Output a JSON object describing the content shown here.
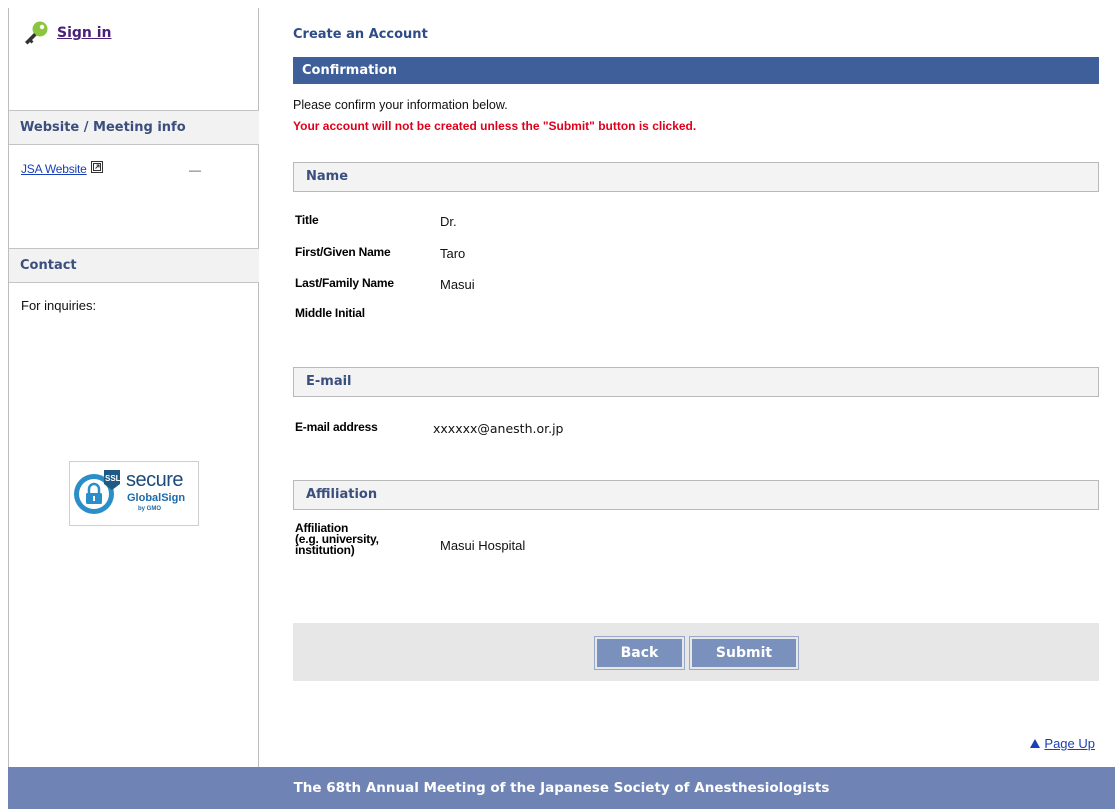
{
  "sidebar": {
    "signin_label": "Sign in",
    "website_heading": "Website / Meeting info",
    "jsa_link": "JSA Website",
    "dash": "—",
    "contact_heading": "Contact",
    "inquiries": "For inquiries:",
    "ssl": {
      "ssl_tag": "SSL",
      "secure": "secure",
      "brand": "GlobalSign",
      "by": "by GMO"
    }
  },
  "main": {
    "page_title": "Create an Account",
    "confirm_heading": "Confirmation",
    "intro": "Please confirm your information below.",
    "warning": "Your account will not be created unless the \"Submit\" button is clicked.",
    "name_section": {
      "heading": "Name",
      "fields": [
        {
          "label": "Title",
          "value": "Dr."
        },
        {
          "label": "First/Given Name",
          "value": "Taro"
        },
        {
          "label": "Last/Family Name",
          "value": "Masui"
        },
        {
          "label": "Middle Initial",
          "value": ""
        }
      ]
    },
    "email_section": {
      "heading": "E-mail",
      "label": "E-mail address",
      "value": "xxxxxx@anesth.or.jp"
    },
    "affiliation_section": {
      "heading": "Affiliation",
      "label_line1": "Affiliation",
      "label_line2": "(e.g. university,",
      "label_line3": "institution)",
      "value": "Masui Hospital"
    },
    "buttons": {
      "back": "Back",
      "submit": "Submit"
    },
    "page_up": "Page Up"
  },
  "footer": {
    "text": "The 68th Annual Meeting of the Japanese Society of Anesthesiologists"
  },
  "colors": {
    "nav_blue": "#3e5f99",
    "footer_blue": "#6f84b4",
    "button_blue": "#7a90bd",
    "warning_red": "#e0001b",
    "heading_text": "#3a4f7d"
  }
}
